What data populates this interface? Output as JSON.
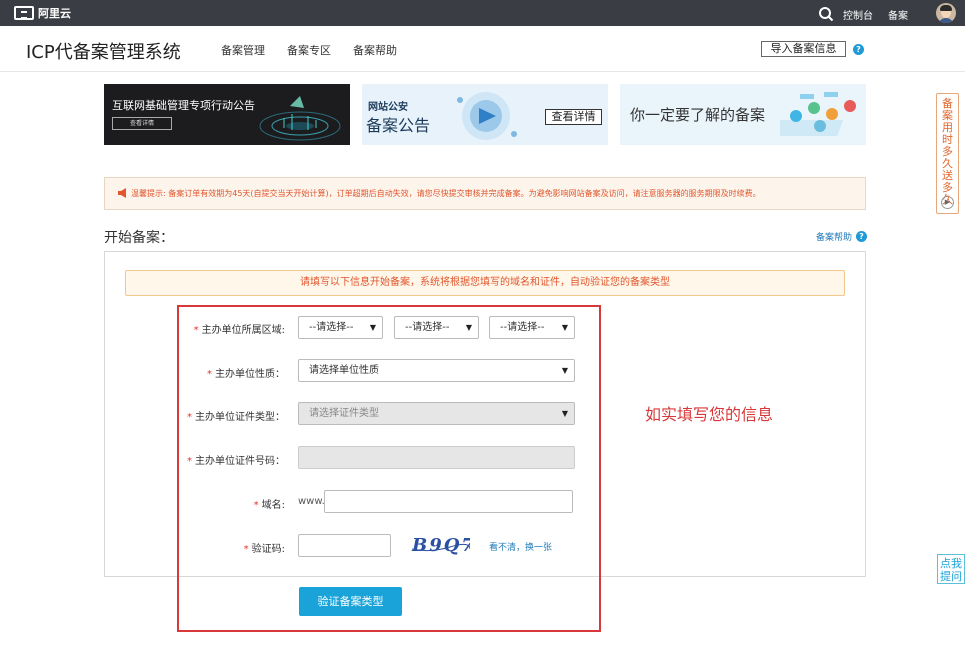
{
  "topbar": {
    "logo_text": "阿里云",
    "console": "控制台",
    "beian": "备案"
  },
  "header": {
    "title": "ICP代备案管理系统",
    "nav": [
      "备案管理",
      "备案专区",
      "备案帮助"
    ],
    "import_button": "导入备案信息"
  },
  "banners": {
    "b1_title": "互联网基础管理专项行动公告",
    "b1_button": "查看详情",
    "b2_small": "网站公安",
    "b2_big": "备案公告",
    "b2_button": "查看详情",
    "b3_title": "你一定要了解的备案"
  },
  "notice": {
    "text": "温馨提示: 备案订单有效期为45天(自提交当天开始计算)，订单超期后自动失效，请您尽快提交审核并完成备案。为避免影响网站备案及访问，请注意服务器的服务期限及时续费。"
  },
  "section": {
    "title": "开始备案：",
    "help_link": "备案帮助"
  },
  "info_bar": "请填写以下信息开始备案，系统将根据您填写的域名和证件，自动验证您的备案类型",
  "hint": "如实填写您的信息",
  "form": {
    "region_label": "主办单位所属区域:",
    "region_options": [
      "--请选择--",
      "--请选择--",
      "--请选择--"
    ],
    "nature_label": "主办单位性质：",
    "nature_value": "请选择单位性质",
    "cert_type_label": "主办单位证件类型：",
    "cert_type_value": "请选择证件类型",
    "cert_no_label": "主办单位证件号码：",
    "domain_label": "域名:",
    "domain_prefix": "www.",
    "captcha_label": "验证码:",
    "captcha_text": "B9Q7",
    "refresh_link": "看不清，换一张",
    "submit_button": "验证备案类型"
  },
  "side": {
    "tab_text": "备案用时多久送多久",
    "ask_text": "点我提问"
  },
  "colors": {
    "topbar": "#3a3d44",
    "accent_blue": "#1aa3d9",
    "alert_orange": "#e0562d",
    "frame_red": "#d9383a"
  }
}
